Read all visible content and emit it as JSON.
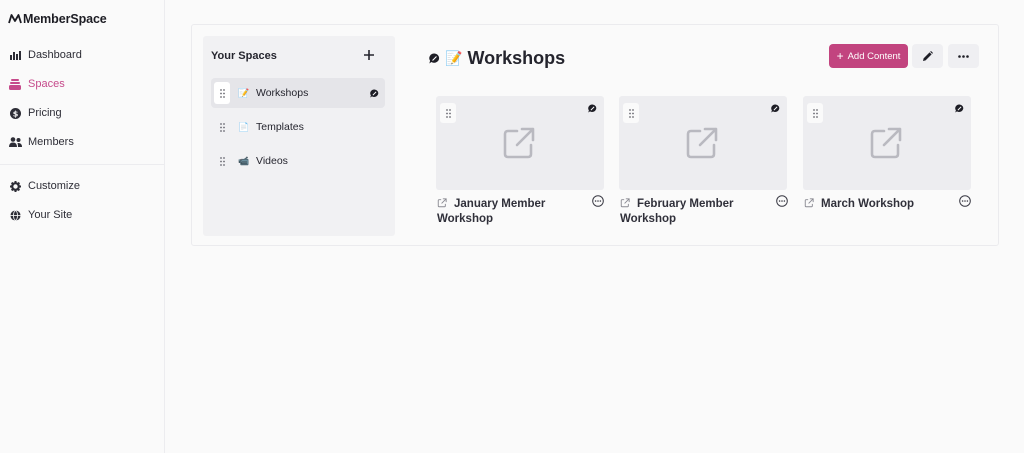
{
  "app": {
    "brand": "MemberSpace"
  },
  "sidebar": {
    "items": [
      {
        "label": "Dashboard",
        "icon": "chart-icon"
      },
      {
        "label": "Spaces",
        "icon": "spaces-icon",
        "active": true
      },
      {
        "label": "Pricing",
        "icon": "dollar-icon"
      },
      {
        "label": "Members",
        "icon": "members-icon"
      },
      {
        "label": "Customize",
        "icon": "gear-icon"
      },
      {
        "label": "Your Site",
        "icon": "globe-icon"
      }
    ]
  },
  "spaces": {
    "title": "Your Spaces",
    "items": [
      {
        "label": "Workshops",
        "emoji": "📝",
        "selected": true
      },
      {
        "label": "Templates",
        "emoji": "📄"
      },
      {
        "label": "Videos",
        "emoji": "📹"
      }
    ]
  },
  "workspace": {
    "emoji": "📝",
    "title": "Workshops",
    "add_content_label": "Add Content"
  },
  "contents": [
    {
      "title": "January Member Workshop"
    },
    {
      "title": "February Member Workshop"
    },
    {
      "title": "March Workshop"
    }
  ],
  "colors": {
    "accent": "#c2447f",
    "active_nav": "#c64a8b"
  }
}
